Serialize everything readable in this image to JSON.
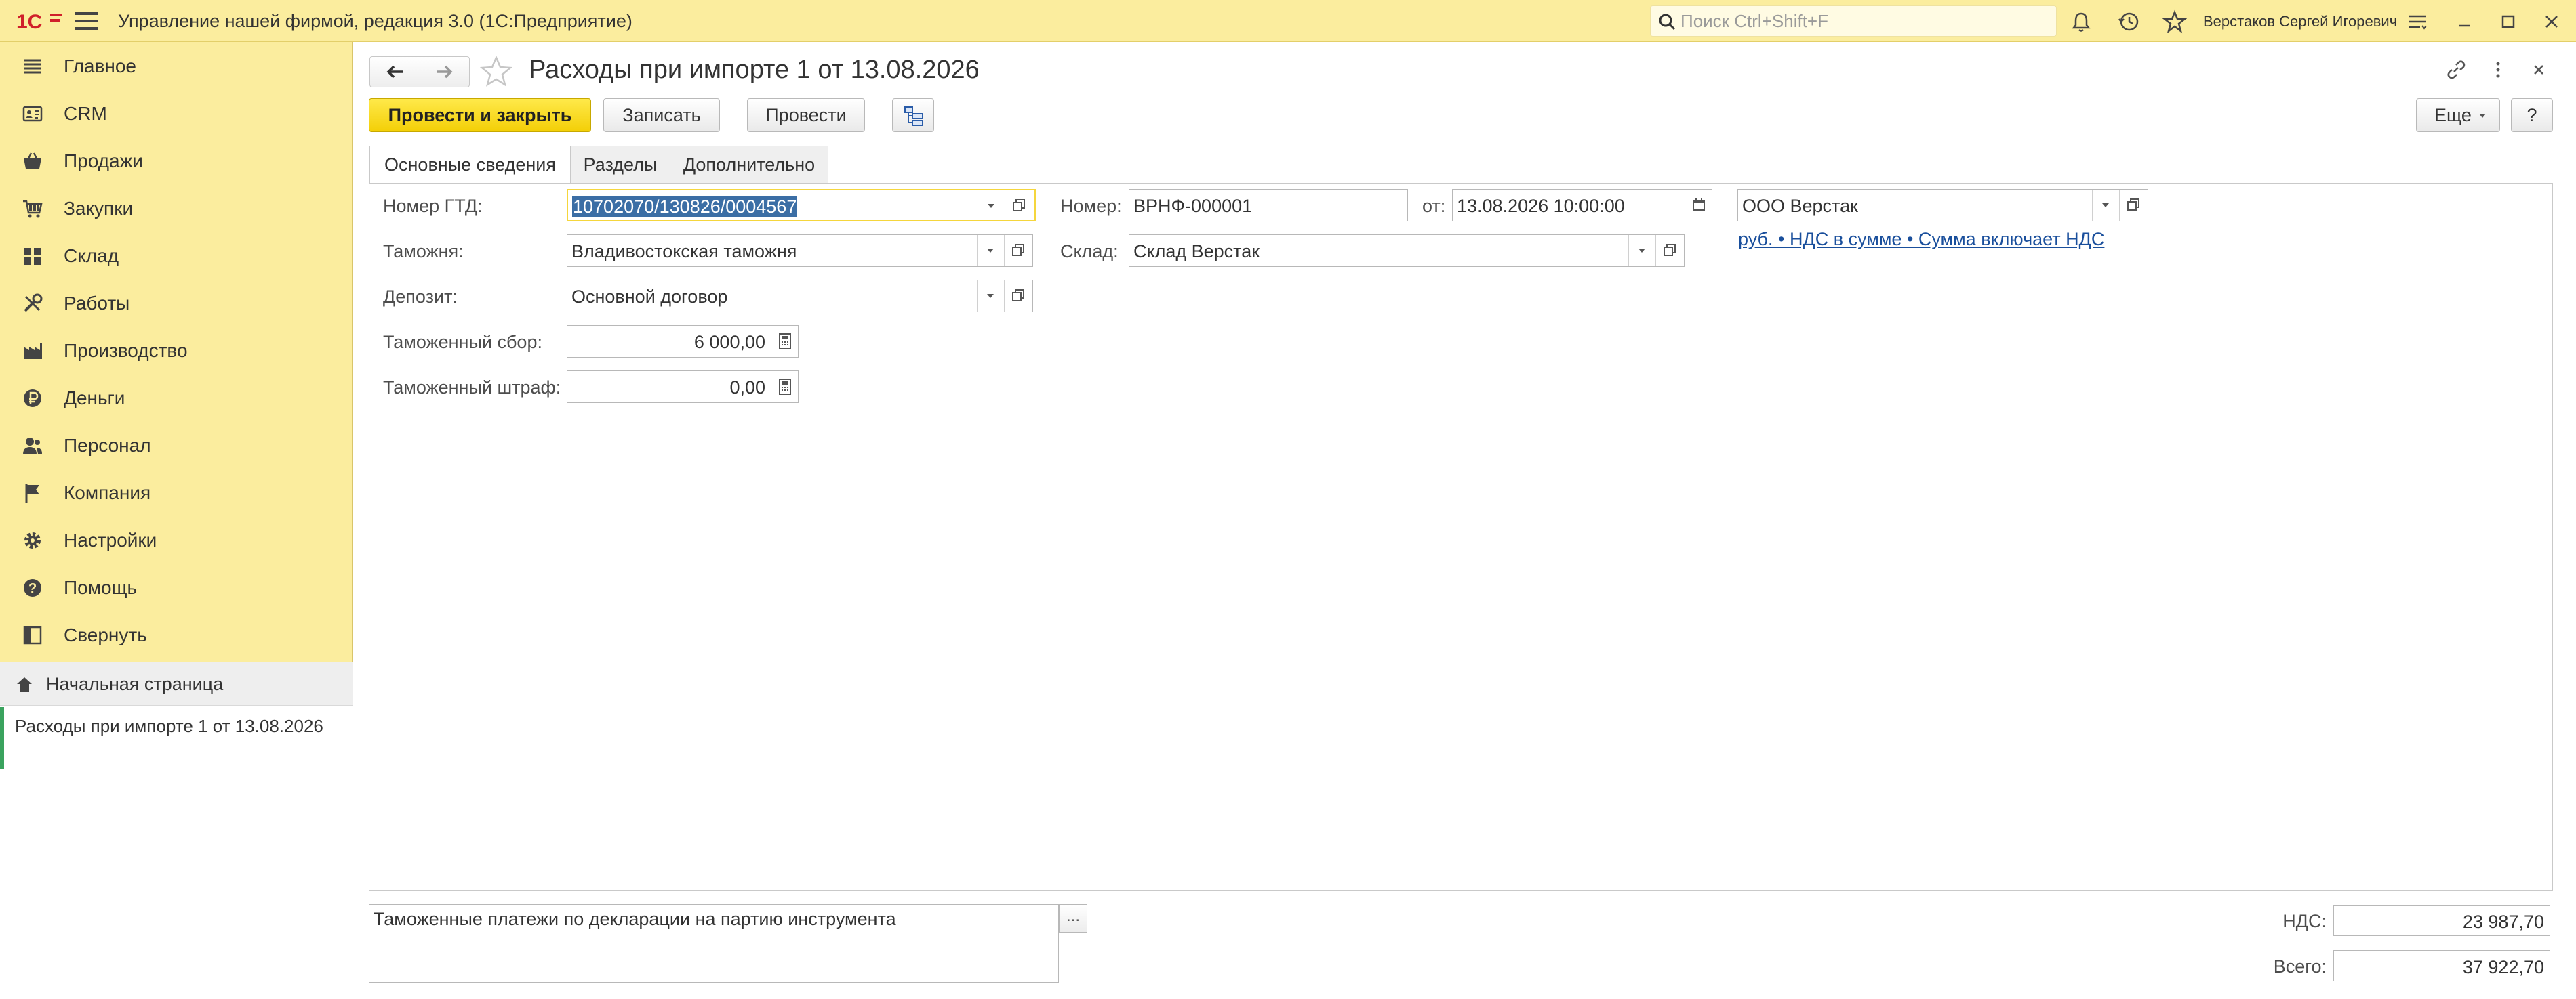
{
  "app": {
    "title": "Управление нашей фирмой, редакция 3.0  (1С:Предприятие)",
    "search_placeholder": "Поиск Ctrl+Shift+F",
    "user": "Верстаков Сергей Игоревич",
    "accent_color": "#fbed9e",
    "primary_button_color": "#f5d50f"
  },
  "sidebar": {
    "items": [
      {
        "label": "Главное",
        "icon": "list-icon"
      },
      {
        "label": "CRM",
        "icon": "contact-card-icon"
      },
      {
        "label": "Продажи",
        "icon": "basket-icon"
      },
      {
        "label": "Закупки",
        "icon": "cart-icon"
      },
      {
        "label": "Склад",
        "icon": "warehouse-grid-icon"
      },
      {
        "label": "Работы",
        "icon": "tools-icon"
      },
      {
        "label": "Производство",
        "icon": "factory-icon"
      },
      {
        "label": "Деньги",
        "icon": "ruble-coin-icon"
      },
      {
        "label": "Персонал",
        "icon": "people-icon"
      },
      {
        "label": "Компания",
        "icon": "flag-icon"
      },
      {
        "label": "Настройки",
        "icon": "gear-icon"
      },
      {
        "label": "Помощь",
        "icon": "help-icon"
      },
      {
        "label": "Свернуть",
        "icon": "collapse-panel-icon"
      }
    ],
    "home": "Начальная страница",
    "open_document": "Расходы при импорте 1 от 13.08.2026"
  },
  "document": {
    "title": "Расходы при импорте 1 от 13.08.2026",
    "buttons": {
      "post_close": "Провести и закрыть",
      "save": "Записать",
      "post": "Провести",
      "more": "Еще",
      "help": "?"
    },
    "tabs": [
      "Основные сведения",
      "Разделы",
      "Дополнительно"
    ],
    "fields": {
      "gtd_label": "Номер ГТД:",
      "gtd_value": "10702070/130826/0004567",
      "customs_label": "Таможня:",
      "customs_value": "Владивостокская таможня",
      "deposit_label": "Депозит:",
      "deposit_value": "Основной договор",
      "fee_label": "Таможенный сбор:",
      "fee_value": "6 000,00",
      "fine_label": "Таможенный штраф:",
      "fine_value": "0,00",
      "number_label": "Номер:",
      "number_value": "ВРНФ-000001",
      "date_label": "от:",
      "date_value": "13.08.2026 10:00:00",
      "warehouse_label": "Склад:",
      "warehouse_value": "Склад Верстак",
      "company_value": "ООО Верстак",
      "tax_link": "руб. • НДС в сумме • Сумма включает НДС"
    },
    "comment": "Таможенные платежи по декларации на партию инструмента",
    "comment_button": "...",
    "totals": {
      "vat_label": "НДС:",
      "vat_value": "23 987,70",
      "total_label": "Всего:",
      "total_value": "37 922,70"
    }
  }
}
